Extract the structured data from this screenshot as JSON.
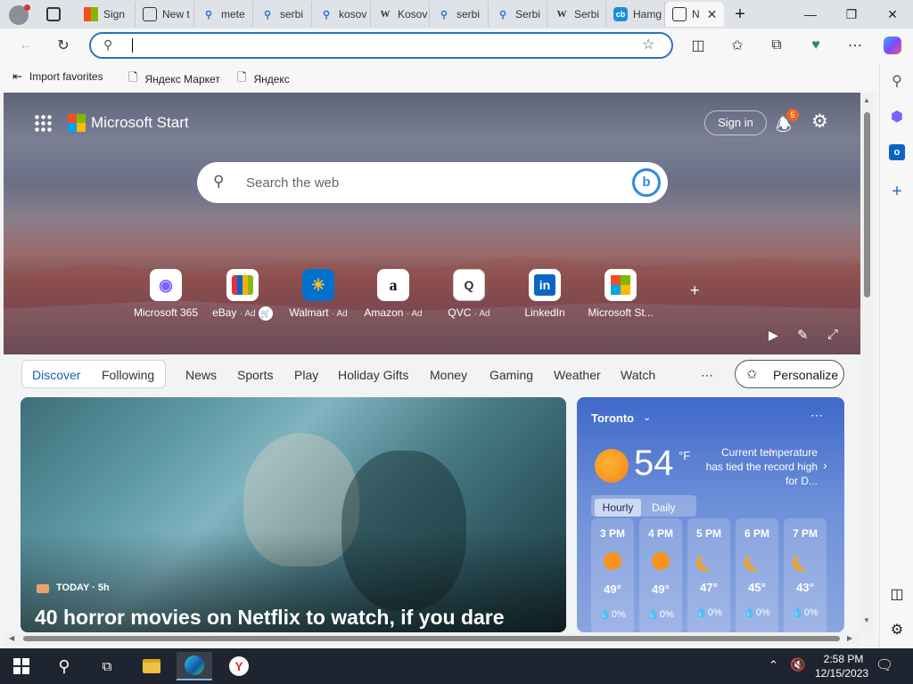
{
  "browser": {
    "tabs": [
      {
        "label": "Sign",
        "icon": "microsoft-icon"
      },
      {
        "label": "New t",
        "icon": "newtab-icon"
      },
      {
        "label": "mete",
        "icon": "search-icon"
      },
      {
        "label": "serbi",
        "icon": "search-icon"
      },
      {
        "label": "kosov",
        "icon": "search-icon"
      },
      {
        "label": "Kosov",
        "icon": "wikipedia-icon"
      },
      {
        "label": "serbi",
        "icon": "search-icon"
      },
      {
        "label": "Serbi",
        "icon": "search-icon"
      },
      {
        "label": "Serbi",
        "icon": "wikipedia-icon"
      },
      {
        "label": "Hamg",
        "icon": "copilot-icon"
      },
      {
        "label": "N",
        "icon": "newtab-icon",
        "active": true
      }
    ],
    "address_value": "",
    "favorites": [
      {
        "label": "Import favorites",
        "icon": "import-icon"
      },
      {
        "label": "Яндекс Маркет",
        "icon": "page-icon"
      },
      {
        "label": "Яндекс",
        "icon": "page-icon"
      }
    ]
  },
  "page": {
    "brand": "Microsoft Start",
    "sign_in": "Sign in",
    "notification_count": "5",
    "search_placeholder": "Search the web",
    "quick_links": [
      {
        "label": "Microsoft 365",
        "ad": "",
        "icon": "m365-icon",
        "glyph": "◉",
        "color": "#7b61ff"
      },
      {
        "label": "eBay",
        "ad": "· Ad",
        "icon": "ebay-icon",
        "glyph": "🛍",
        "color": "#e53238"
      },
      {
        "label": "Walmart",
        "ad": "· Ad",
        "icon": "walmart-icon",
        "glyph": "✳",
        "color": "#0071ce"
      },
      {
        "label": "Amazon",
        "ad": "· Ad",
        "icon": "amazon-icon",
        "glyph": "a",
        "color": "#111111"
      },
      {
        "label": "QVC",
        "ad": "· Ad",
        "icon": "qvc-icon",
        "glyph": "Q",
        "color": "#333333"
      },
      {
        "label": "LinkedIn",
        "ad": "",
        "icon": "linkedin-icon",
        "glyph": "in",
        "color": "#0a66c2"
      },
      {
        "label": "Microsoft St...",
        "ad": "",
        "icon": "msstore-icon",
        "glyph": "▦",
        "color": "#f25022"
      }
    ],
    "nav_tabs": [
      "Discover",
      "Following",
      "News",
      "Sports",
      "Play",
      "Holiday Gifts",
      "Money",
      "Gaming",
      "Weather",
      "Watch"
    ],
    "personalize": "Personalize",
    "news": {
      "source": "TODAY · 5h",
      "headline": "40 horror movies on Netflix to watch, if you dare"
    },
    "weather": {
      "city": "Toronto",
      "temp": "54",
      "unit": "°F",
      "note": "Current temperature has tied the record high for D...",
      "tabs": [
        "Hourly",
        "Daily"
      ],
      "hours": [
        {
          "time": "3 PM",
          "temp": "49°",
          "precip": "0%",
          "icon": "sun"
        },
        {
          "time": "4 PM",
          "temp": "49°",
          "precip": "0%",
          "icon": "sun"
        },
        {
          "time": "5 PM",
          "temp": "47°",
          "precip": "0%",
          "icon": "moon"
        },
        {
          "time": "6 PM",
          "temp": "45°",
          "precip": "0%",
          "icon": "moon"
        },
        {
          "time": "7 PM",
          "temp": "43°",
          "precip": "0%",
          "icon": "moon"
        }
      ]
    }
  },
  "taskbar": {
    "time": "2:58 PM",
    "date": "12/15/2023"
  }
}
